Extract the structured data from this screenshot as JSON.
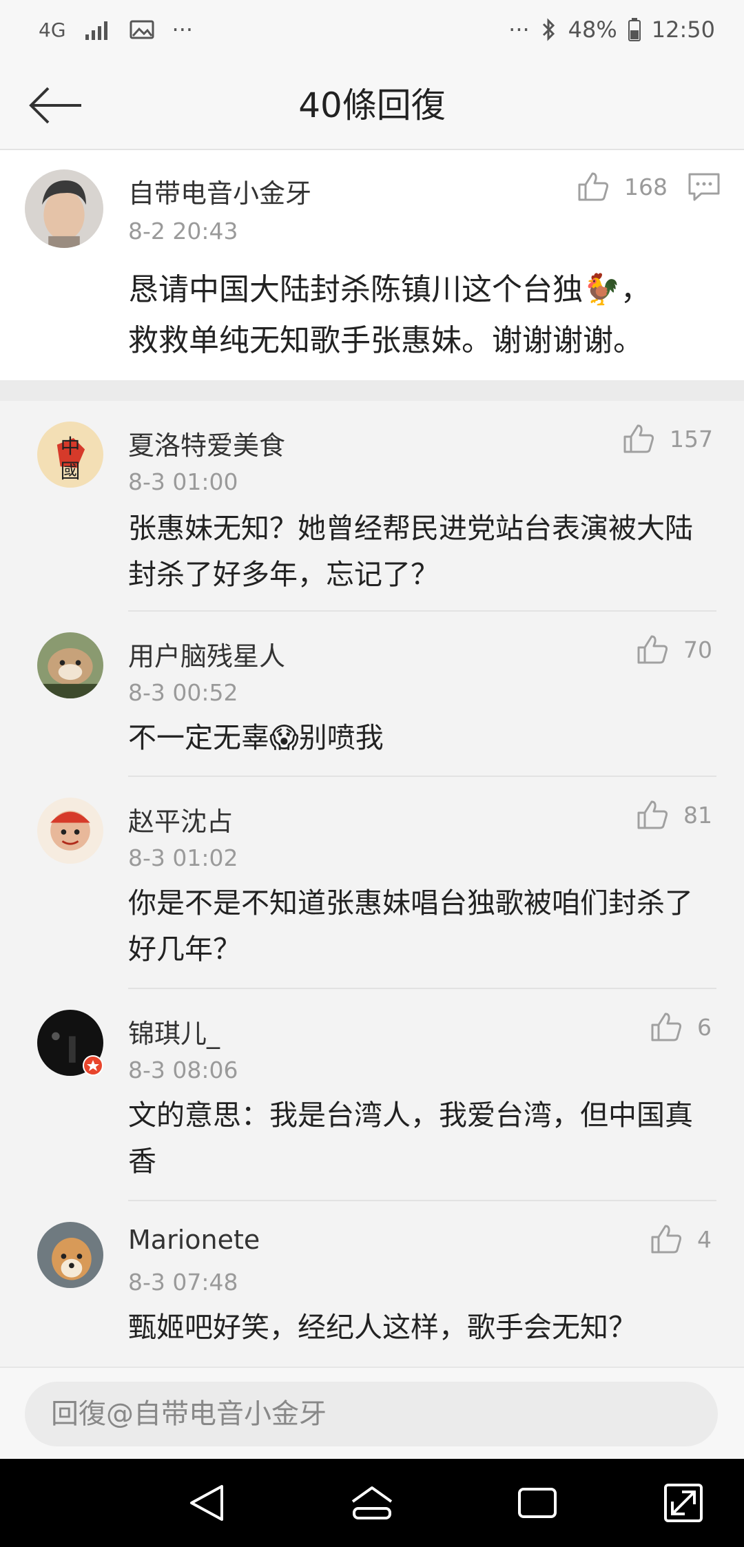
{
  "status_bar": {
    "network": "4G",
    "dots_left": "···",
    "dots_right": "···",
    "battery": "48%",
    "time": "12:50"
  },
  "header": {
    "title": "40條回復"
  },
  "main_comment": {
    "username": "自带电音小金牙",
    "time": "8-2 20:43",
    "likes": "168",
    "content_line1": "恳请中国大陆封杀陈镇川这个台独🐓，",
    "content_line2": "救救单纯无知歌手张惠妹。谢谢谢谢。"
  },
  "replies": [
    {
      "username": "夏洛特爱美食",
      "time": "8-3 01:00",
      "likes": "157",
      "line1": "张惠妹无知？她曾经帮民进党站台表演被大陆",
      "line2": "封杀了好多年，忘记了？"
    },
    {
      "username": "用户脑残星人",
      "time": "8-3 00:52",
      "likes": "70",
      "line1": "不一定无辜😱别喷我",
      "line2": ""
    },
    {
      "username": "赵平沈占",
      "time": "8-3 01:02",
      "likes": "81",
      "line1": "你是不是不知道张惠妹唱台独歌被咱们封杀了",
      "line2": "好几年？"
    },
    {
      "username": "锦琪儿_",
      "time": "8-3 08:06",
      "likes": "6",
      "line1": "文的意思：我是台湾人，我爱台湾，但中国真",
      "line2": "香"
    },
    {
      "username": "Marionete",
      "time": "8-3 07:48",
      "likes": "4",
      "line1": "甄姬吧好笑，经纪人这样，歌手会无知？",
      "line2": ""
    }
  ],
  "input": {
    "placeholder": "回復@自带电音小金牙"
  }
}
